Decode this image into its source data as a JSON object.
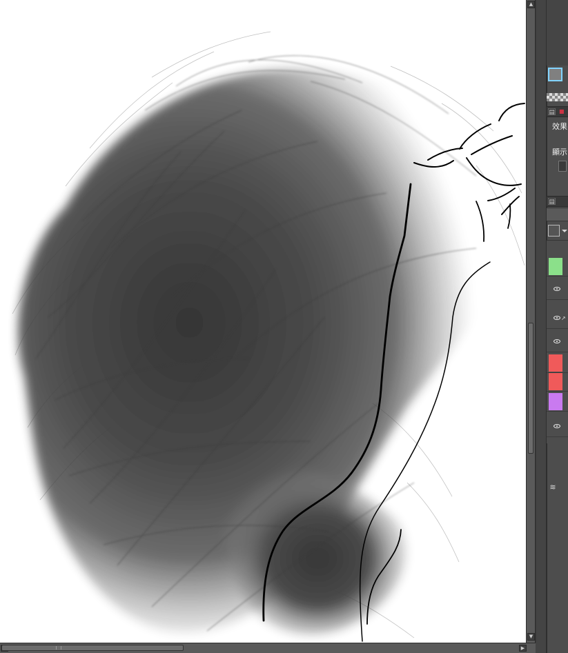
{
  "app": {
    "canvas_label": "",
    "right_panel": {
      "effect_label": "效果",
      "display_label": "顯示"
    },
    "scrollbar": {
      "up_arrow": "▲",
      "down_arrow": "▼",
      "left_arrow": "◀",
      "right_arrow": "▶"
    },
    "layers": [
      {
        "color": "#8be08a",
        "visible": false
      },
      {
        "color": "#4d4d4d",
        "visible": true
      },
      {
        "color": "#4d4d4d",
        "visible": true,
        "brush": true
      },
      {
        "color": "#4d4d4d",
        "visible": true
      },
      {
        "color": "#f05a5a",
        "visible": false
      },
      {
        "color": "#f05a5a",
        "visible": false
      },
      {
        "color": "#c97af0",
        "visible": false
      },
      {
        "color": "#4d4d4d",
        "visible": true
      }
    ],
    "icons": {
      "panel_icon": "▤",
      "brush_icon": "↗",
      "hatching_icon": "≋"
    }
  }
}
